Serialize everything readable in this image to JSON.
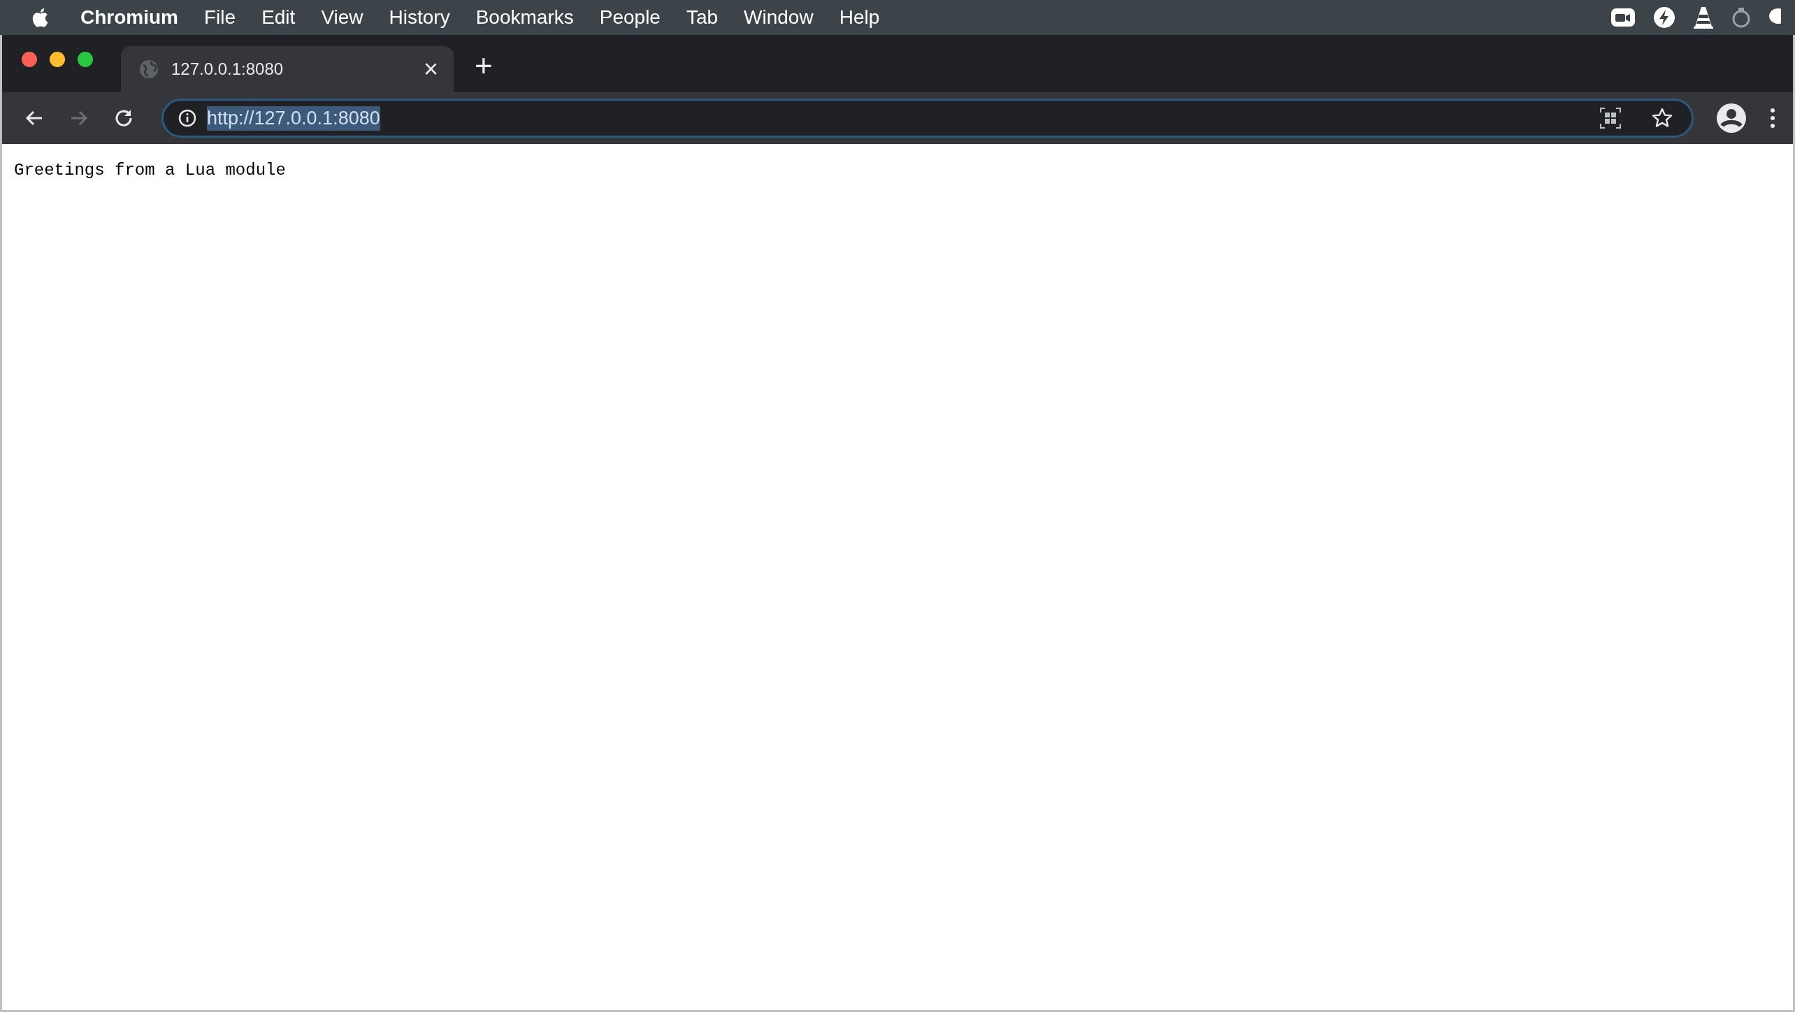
{
  "menu_bar": {
    "app_name": "Chromium",
    "items": [
      "File",
      "Edit",
      "View",
      "History",
      "Bookmarks",
      "People",
      "Tab",
      "Window",
      "Help"
    ]
  },
  "tabs": [
    {
      "title": "127.0.0.1:8080",
      "close": "×",
      "selected": true
    }
  ],
  "new_tab": "+",
  "address_bar": {
    "url": "http://127.0.0.1:8080",
    "text_selected": true
  },
  "page": {
    "text": "Greetings from a Lua module"
  }
}
